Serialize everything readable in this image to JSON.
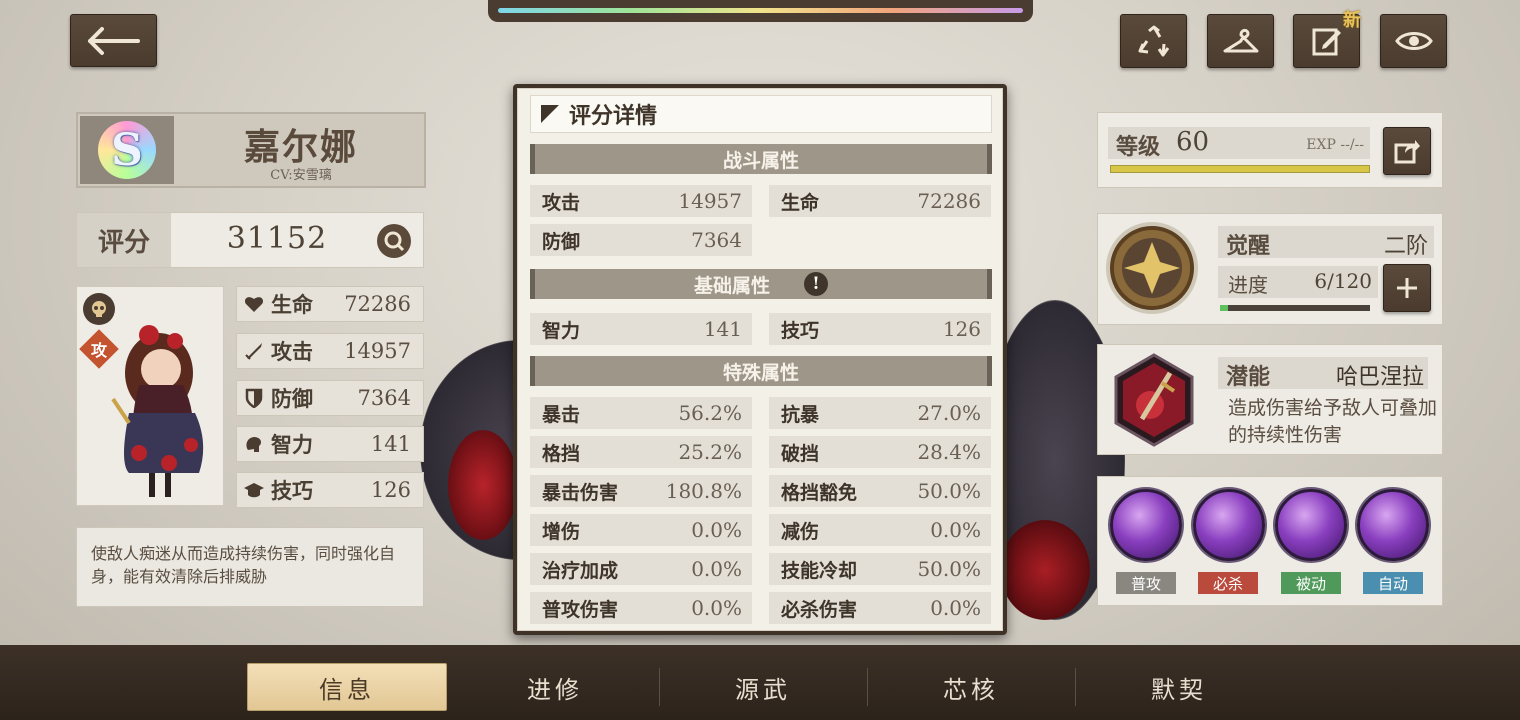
{
  "header": {
    "new_badge": "新"
  },
  "character": {
    "rank": "S",
    "name": "嘉尔娜",
    "cv": "CV:安雪璃",
    "role_badge": "攻"
  },
  "score": {
    "label": "评分",
    "value": "31152"
  },
  "stats": [
    {
      "label": "生命",
      "value": "72286",
      "icon": "heart-icon"
    },
    {
      "label": "攻击",
      "value": "14957",
      "icon": "sword-icon"
    },
    {
      "label": "防御",
      "value": "7364",
      "icon": "shield-icon"
    },
    {
      "label": "智力",
      "value": "141",
      "icon": "brain-icon"
    },
    {
      "label": "技巧",
      "value": "126",
      "icon": "graduation-cap-icon"
    }
  ],
  "description": "使敌人痴迷从而造成持续伤害，同时强化自身，能有效清除后排威胁",
  "modal": {
    "title": "评分详情",
    "combat": {
      "header": "战斗属性",
      "cells": [
        {
          "k": "攻击",
          "v": "14957"
        },
        {
          "k": "生命",
          "v": "72286"
        },
        {
          "k": "防御",
          "v": "7364"
        }
      ]
    },
    "basic": {
      "header": "基础属性",
      "cells": [
        {
          "k": "智力",
          "v": "141"
        },
        {
          "k": "技巧",
          "v": "126"
        }
      ]
    },
    "special": {
      "header": "特殊属性",
      "cells": [
        {
          "k": "暴击",
          "v": "56.2%"
        },
        {
          "k": "抗暴",
          "v": "27.0%"
        },
        {
          "k": "格挡",
          "v": "25.2%"
        },
        {
          "k": "破挡",
          "v": "28.4%"
        },
        {
          "k": "暴击伤害",
          "v": "180.8%"
        },
        {
          "k": "格挡豁免",
          "v": "50.0%"
        },
        {
          "k": "增伤",
          "v": "0.0%"
        },
        {
          "k": "减伤",
          "v": "0.0%"
        },
        {
          "k": "治疗加成",
          "v": "0.0%"
        },
        {
          "k": "技能冷却",
          "v": "50.0%"
        },
        {
          "k": "普攻伤害",
          "v": "0.0%"
        },
        {
          "k": "必杀伤害",
          "v": "0.0%"
        }
      ]
    }
  },
  "level": {
    "label": "等级",
    "value": "60",
    "exp": "EXP --/--"
  },
  "awakening": {
    "label": "觉醒",
    "stage": "二阶",
    "progress_label": "进度",
    "progress": "6/120",
    "progress_fraction": 0.05
  },
  "potential": {
    "label": "潜能",
    "name": "哈巴涅拉",
    "desc": "造成伤害给予敌人可叠加的持续性伤害"
  },
  "skills": [
    {
      "tag": "普攻",
      "color": "#8a8680"
    },
    {
      "tag": "必杀",
      "color": "#b94a3c"
    },
    {
      "tag": "被动",
      "color": "#4f9a5a"
    },
    {
      "tag": "自动",
      "color": "#4b8fb0"
    }
  ],
  "tabs": [
    "信息",
    "进修",
    "源武",
    "芯核",
    "默契"
  ]
}
